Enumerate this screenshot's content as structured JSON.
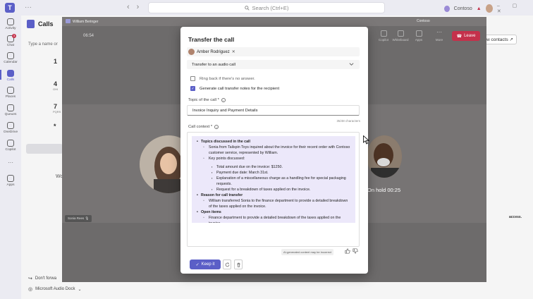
{
  "topbar": {
    "search_placeholder": "Search (Ctrl+E)",
    "org_name": "Contoso"
  },
  "rail": {
    "items": [
      {
        "label": "Activity"
      },
      {
        "label": "Chat",
        "badge": "3"
      },
      {
        "label": "Calendar"
      },
      {
        "label": "Calls"
      },
      {
        "label": "Places"
      },
      {
        "label": "Queues"
      },
      {
        "label": "OneDrive"
      },
      {
        "label": "Copilot"
      },
      {
        "label": "Apps"
      }
    ]
  },
  "calls": {
    "title": "Calls",
    "type_name_placeholder": "Type a name or",
    "dialpad": [
      {
        "digit": "1",
        "sub": ""
      },
      {
        "digit": "4",
        "sub": "GHI"
      },
      {
        "digit": "7",
        "sub": "PQRS"
      },
      {
        "digit": "*",
        "sub": ""
      }
    ],
    "list_label": "Wo",
    "bottom_items": [
      "Don't forwa",
      "Microsoft Audio Dock"
    ],
    "new_contacts_label": "w contacts",
    "access_text": "access."
  },
  "call_window": {
    "caller": "William Beringer",
    "org": "Contoso",
    "timer": "06:54",
    "tools": [
      "Copilot",
      "Whiteboard",
      "Apps",
      "More"
    ],
    "leave_label": "Leave",
    "left_participant": "Sonia Rees",
    "hold_status": "On hold 00:25"
  },
  "dialog": {
    "title": "Transfer the call",
    "recipient": "Amber Rodriguez",
    "transfer_type": "Transfer to an audio call",
    "ring_back_label": "Ring back if there's no answer.",
    "ring_back_checked": false,
    "generate_notes_label": "Generate call transfer notes for the recipient",
    "generate_notes_checked": true,
    "topic_label": "Topic of the call *",
    "topic_value": "Invoice Inquiry and Payment Details",
    "char_count": "35/48 characters",
    "context_label": "Call context *",
    "context": {
      "section1_title": "Topics discussed in the call",
      "section1_sub": "Sonia from Tailspin Toys inquired about the invoice for their recent order with Contoso customer service, represented by William.",
      "key_points_label": "Key points discussed:",
      "key_points": [
        "Total amount due on the invoice: $1250.",
        "Payment due date: March 31st.",
        "Explanation of a miscellaneous charge as a handling fee for special packaging requests.",
        "Request for a breakdown of taxes applied on the invoice."
      ],
      "section2_title": "Reason for call transfer",
      "section2_sub": "William transferred Sonia to the finance department to provide a detailed breakdown of the taxes applied on the invoice.",
      "section3_title": "Open items",
      "section3_sub": "Finance department to provide a detailed breakdown of the taxes applied on the invoice."
    },
    "ai_note": "AI-generated content may be incorrect",
    "keep_label": "Keep it"
  }
}
